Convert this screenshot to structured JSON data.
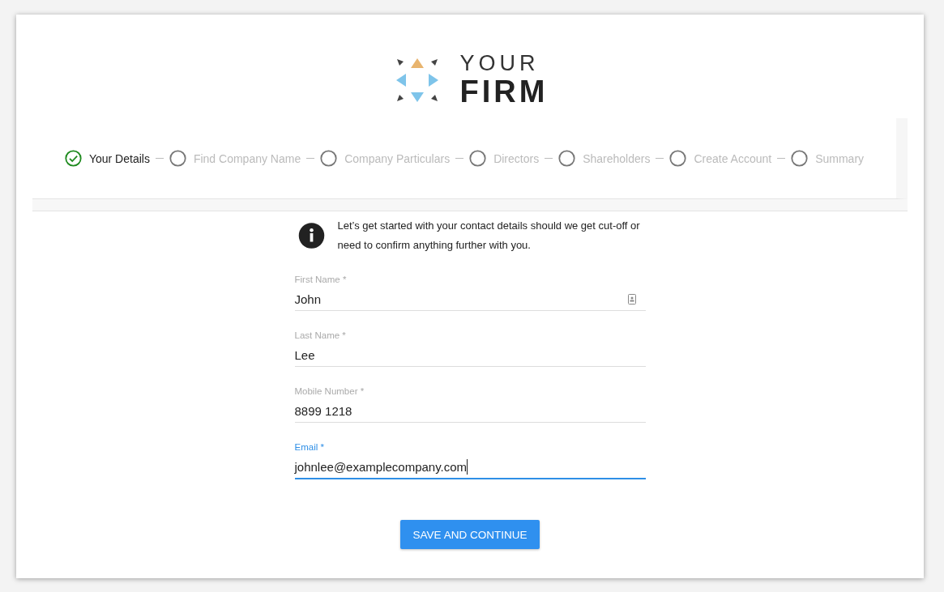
{
  "logo": {
    "line_1": "YOUR",
    "line_2": "FIRM"
  },
  "steps": [
    {
      "label": "Your Details",
      "completed": true
    },
    {
      "label": "Find Company Name",
      "completed": false
    },
    {
      "label": "Company Particulars",
      "completed": false
    },
    {
      "label": "Directors",
      "completed": false
    },
    {
      "label": "Shareholders",
      "completed": false
    },
    {
      "label": "Create Account",
      "completed": false
    },
    {
      "label": "Summary",
      "completed": false
    }
  ],
  "info": "Let’s get started with your contact details should we get cut-off or need to confirm anything further with you.",
  "fields": [
    {
      "label": "First Name *",
      "value": "John",
      "focused": false,
      "autofill_icon": true
    },
    {
      "label": "Last Name *",
      "value": "Lee",
      "focused": false,
      "autofill_icon": false
    },
    {
      "label": "Mobile Number *",
      "value": "8899 1218",
      "focused": false,
      "autofill_icon": false
    },
    {
      "label": "Email *",
      "value": "johnlee@examplecompany.com",
      "focused": true,
      "autofill_icon": false
    }
  ],
  "button": "SAVE AND CONTINUE"
}
